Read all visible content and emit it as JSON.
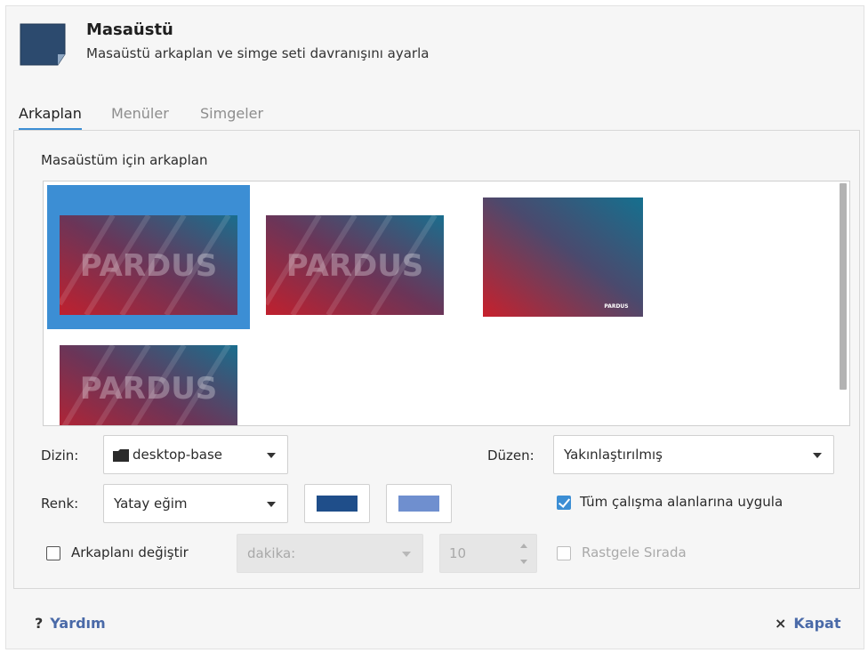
{
  "header": {
    "title": "Masaüstü",
    "subtitle": "Masaüstü arkaplan ve simge seti davranışını ayarla",
    "icon": "desktop-icon"
  },
  "tabs": [
    {
      "label": "Arkaplan",
      "active": true
    },
    {
      "label": "Menüler",
      "active": false
    },
    {
      "label": "Simgeler",
      "active": false
    }
  ],
  "background": {
    "label": "Masaüstüm için arkaplan",
    "thumbnails": [
      {
        "caption": "PARDUS",
        "selected": true
      },
      {
        "caption": "PARDUS",
        "selected": false
      },
      {
        "caption": "PARDUS",
        "selected": false
      },
      {
        "caption": "PARDUS",
        "selected": false
      }
    ]
  },
  "controls": {
    "directory_label": "Dizin:",
    "directory_value": "desktop-base",
    "folder_icon": "folder-icon",
    "layout_label": "Düzen:",
    "layout_value": "Yakınlaştırılmış",
    "color_label": "Renk:",
    "color_value": "Yatay eğim",
    "primary_color": "#1f4e8a",
    "secondary_color": "#6f8fcf",
    "apply_all_label": "Tüm çalışma alanlarına uygula",
    "apply_all_checked": true,
    "change_bg_label": "Arkaplanı değiştir",
    "change_bg_checked": false,
    "interval_placeholder": "dakika:",
    "interval_value": "10",
    "random_label": "Rastgele Sırada",
    "random_checked": false
  },
  "footer": {
    "help_icon": "?",
    "help_label": "Yardım",
    "close_icon": "×",
    "close_label": "Kapat"
  },
  "colors": {
    "accent": "#3c8ed4",
    "link": "#4a6aa8"
  }
}
